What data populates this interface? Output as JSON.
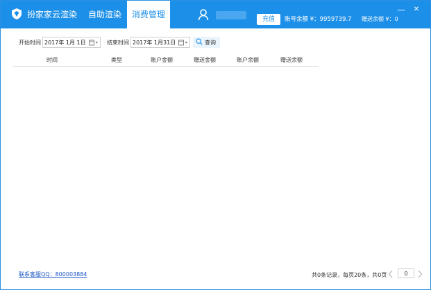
{
  "titlebar": {
    "app_name": "扮家家云渲染",
    "tabs": [
      {
        "label": "自助渲染"
      },
      {
        "label": "消费管理",
        "active": true
      }
    ],
    "recharge_label": "充值",
    "balance_text": "账号余额 ¥：9959739.7",
    "gift_balance_text": "赠送余额 ¥：0",
    "minimize_symbol": "—",
    "close_symbol": "✕",
    "accent_color": "#1c8fe8"
  },
  "filters": {
    "start_label": "开始时间",
    "start_date": "2017年 1月 1日",
    "end_label": "结束时间",
    "end_date": "2017年 1月31日",
    "query_label": "查询"
  },
  "table": {
    "columns": [
      "时间",
      "类型",
      "账户金额",
      "赠送金额",
      "账户余额",
      "赠送余额"
    ],
    "rows": []
  },
  "footer": {
    "support_text": "联系客服QQ：800003884",
    "pager_text": "共0条记录，每页20条，共0页",
    "page_value": "0"
  },
  "icons": {
    "logo": "shield-logo-icon",
    "user": "user-icon",
    "calendar": "calendar-icon",
    "search": "search-icon",
    "prev": "chevron-left-icon",
    "next": "chevron-right-icon"
  }
}
